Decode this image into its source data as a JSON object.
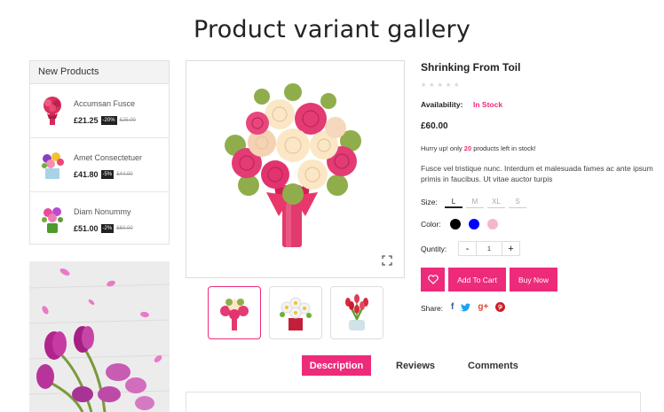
{
  "page": {
    "title": "Product variant gallery"
  },
  "sidebar": {
    "heading": "New Products",
    "items": [
      {
        "name": "Accumsan Fusce",
        "price": "£21.25",
        "discount": "-20%",
        "old_price": "£25.00"
      },
      {
        "name": "Amet Consectetuer",
        "price": "£41.80",
        "discount": "-5%",
        "old_price": "£44.00"
      },
      {
        "name": "Diam Nonummy",
        "price": "£51.00",
        "discount": "-2%",
        "old_price": "£60.00"
      }
    ]
  },
  "product": {
    "title": "Shrinking From Toil",
    "rating": 0,
    "availability_label": "Availability:",
    "availability_value": "In Stock",
    "price": "£60.00",
    "hurry_prefix": "Hurry up! only",
    "hurry_count": "20",
    "hurry_suffix": "products left in stock!",
    "description": "Fusce vel tristique nunc. Interdum et malesuada fames ac ante ipsum primis in faucibus. Ut vitae auctor turpis",
    "size_label": "Size:",
    "sizes": [
      "L",
      "M",
      "XL",
      "S"
    ],
    "selected_size": "L",
    "color_label": "Color:",
    "colors": [
      "#000000",
      "#0000ff",
      "#f7b6c8"
    ],
    "qty_label": "Quntity:",
    "qty_minus": "-",
    "qty_value": "1",
    "qty_plus": "+",
    "add_to_cart": "Add To Cart",
    "buy_now": "Buy Now",
    "share_label": "Share:",
    "share_icons": {
      "facebook": "f",
      "googleplus": "g+"
    }
  },
  "tabs": {
    "description": "Description",
    "reviews": "Reviews",
    "comments": "Comments"
  },
  "panel": {
    "heading": ""
  },
  "colors": {
    "accent": "#ee2b7a"
  }
}
